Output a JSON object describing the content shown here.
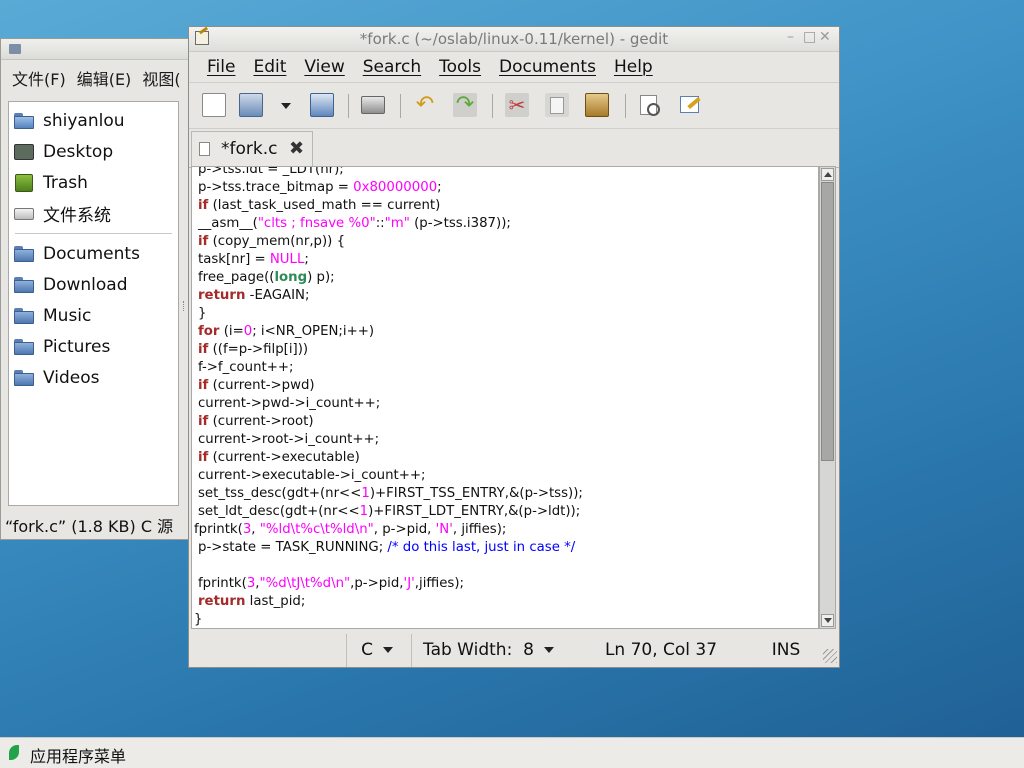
{
  "file_manager": {
    "menus": [
      "文件(F)",
      "编辑(E)",
      "视图("
    ],
    "places": [
      {
        "label": "shiyanlou",
        "icon": "home-folder-icon"
      },
      {
        "label": "Desktop",
        "icon": "desktop-icon"
      },
      {
        "label": "Trash",
        "icon": "trash-icon"
      },
      {
        "label": "文件系统",
        "icon": "drive-icon"
      }
    ],
    "bookmarks": [
      {
        "label": "Documents",
        "icon": "folder-icon"
      },
      {
        "label": "Download",
        "icon": "folder-icon"
      },
      {
        "label": "Music",
        "icon": "folder-icon"
      },
      {
        "label": "Pictures",
        "icon": "folder-icon"
      },
      {
        "label": "Videos",
        "icon": "folder-icon"
      }
    ],
    "status": "“fork.c” (1.8 KB) C 源"
  },
  "gedit": {
    "title": "*fork.c (~/oslab/linux-0.11/kernel) - gedit",
    "menus": [
      "File",
      "Edit",
      "View",
      "Search",
      "Tools",
      "Documents",
      "Help"
    ],
    "tab_label": "*fork.c",
    "tab_close": "✖",
    "code_lines": [
      [
        [
          "",
          "p->tss.ldt = _LDT(nr);"
        ]
      ],
      [
        [
          "",
          "p->tss.trace_bitmap = "
        ],
        [
          "num",
          "0x80000000"
        ],
        [
          "",
          ";"
        ]
      ],
      [
        [
          "kw",
          "if"
        ],
        [
          "",
          " (last_task_used_math == current)"
        ]
      ],
      [
        [
          "",
          "__asm__("
        ],
        [
          "str",
          "\"clts ; fnsave %0\""
        ],
        [
          "",
          "::"
        ],
        [
          "str",
          "\"m\""
        ],
        [
          "",
          " (p->tss.i387));"
        ]
      ],
      [
        [
          "kw",
          "if"
        ],
        [
          "",
          " (copy_mem(nr,p)) {"
        ]
      ],
      [
        [
          "",
          "task[nr] = "
        ],
        [
          "num",
          "NULL"
        ],
        [
          "",
          ";"
        ]
      ],
      [
        [
          "",
          "free_page(("
        ],
        [
          "ty",
          "long"
        ],
        [
          "",
          ") p);"
        ]
      ],
      [
        [
          "kw",
          "return"
        ],
        [
          "",
          " -EAGAIN;"
        ]
      ],
      [
        [
          "",
          "}"
        ]
      ],
      [
        [
          "kw",
          "for"
        ],
        [
          "",
          " (i="
        ],
        [
          "num",
          "0"
        ],
        [
          "",
          "; i<NR_OPEN;i++)"
        ]
      ],
      [
        [
          "kw",
          "if"
        ],
        [
          "",
          " ((f=p->filp[i]))"
        ]
      ],
      [
        [
          "",
          "f->f_count++;"
        ]
      ],
      [
        [
          "kw",
          "if"
        ],
        [
          "",
          " (current->pwd)"
        ]
      ],
      [
        [
          "",
          "current->pwd->i_count++;"
        ]
      ],
      [
        [
          "kw",
          "if"
        ],
        [
          "",
          " (current->root)"
        ]
      ],
      [
        [
          "",
          "current->root->i_count++;"
        ]
      ],
      [
        [
          "kw",
          "if"
        ],
        [
          "",
          " (current->executable)"
        ]
      ],
      [
        [
          "",
          "current->executable->i_count++;"
        ]
      ],
      [
        [
          "",
          "set_tss_desc(gdt+(nr<<"
        ],
        [
          "num",
          "1"
        ],
        [
          "",
          ")+FIRST_TSS_ENTRY,&(p->tss));"
        ]
      ],
      [
        [
          "",
          "set_ldt_desc(gdt+(nr<<"
        ],
        [
          "num",
          "1"
        ],
        [
          "",
          ")+FIRST_LDT_ENTRY,&(p->ldt));"
        ]
      ],
      [
        [
          "",
          "fprintk("
        ],
        [
          "num",
          "3"
        ],
        [
          "",
          ", "
        ],
        [
          "str",
          "\"%ld\\t%c\\t%ld\\n\""
        ],
        [
          "",
          ", p->pid, "
        ],
        [
          "str",
          "'N'"
        ],
        [
          "",
          ", jiffies);"
        ]
      ],
      [
        [
          "",
          "p->state = TASK_RUNNING; "
        ],
        [
          "cm",
          "/* do this last, just in case */"
        ]
      ],
      [
        [
          "",
          ""
        ]
      ],
      [
        [
          "",
          "fprintk("
        ],
        [
          "num",
          "3"
        ],
        [
          "",
          ","
        ],
        [
          "str",
          "\"%d\\tJ\\t%d\\n\""
        ],
        [
          "",
          ",p->pid,"
        ],
        [
          "str",
          "'J'"
        ],
        [
          "",
          ",jiffies);"
        ]
      ],
      [
        [
          "kw",
          "return"
        ],
        [
          "",
          " last_pid;"
        ]
      ],
      [
        [
          "",
          "}"
        ]
      ]
    ],
    "code_indent": [
      1,
      1,
      1,
      1,
      1,
      1,
      1,
      1,
      1,
      1,
      1,
      1,
      1,
      1,
      1,
      1,
      1,
      1,
      1,
      1,
      0,
      1,
      0,
      1,
      1,
      0
    ],
    "status": {
      "language": "C",
      "tab_width": "Tab Width:  8",
      "position": "Ln 70, Col 37",
      "mode": "INS"
    },
    "scroll_position": 0.64
  },
  "panel": {
    "label": "应用程序菜单"
  },
  "colors": {
    "keyword": "#a52a2a",
    "type": "#2e8b57",
    "literal": "#ff00ff",
    "comment": "#0000ff"
  }
}
